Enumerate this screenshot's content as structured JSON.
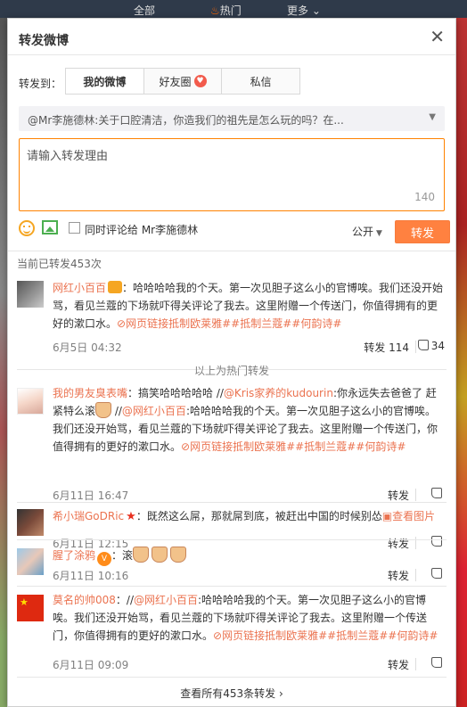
{
  "topnav": {
    "all": "全部",
    "hot": "热门",
    "more": "更多"
  },
  "dialog": {
    "title": "转发微博",
    "forward_to_label": "转发到：",
    "tabs": [
      {
        "label": "我的微博",
        "active": true
      },
      {
        "label": "好友圈",
        "active": false
      },
      {
        "label": "私信",
        "active": false
      }
    ],
    "quoted": "@Mr李施德林:关于口腔清洁，你造我们的祖先是怎么玩的吗？在...",
    "input_placeholder": "请输入转发理由",
    "char_count": "140",
    "also_comment_label": "同时评论给 Mr李施德林",
    "visibility": "公开",
    "forward_button": "转发",
    "count_line": "当前已转发453次",
    "hot_divider": "以上为热门转发",
    "footer_link": "查看所有453条转发",
    "accent_color": "#ff8140",
    "link_color": "#eb7350"
  },
  "items": [
    {
      "user": "网红小百百",
      "text": "：哈哈哈哈我的个天。第一次见胆子这么小的官博唉。我们还没开始骂，看见兰蔻的下场就吓得关评论了我去。这里附赠一个传送门，你值得拥有的更好的漱口水。",
      "link": "网页链接",
      "tail": "抵制欧莱雅##抵制兰蔻##何韵诗#",
      "date": "6月5日 04:32",
      "forward": "转发 114",
      "likes": "34"
    },
    {
      "user": "我的男友臭表嘴",
      "text1": "：搞笑哈哈哈哈哈 //",
      "mention1": "@Kris家养的kudourin",
      "text2": ":你永远失去爸爸了 赶紧特么滚",
      "text3": " //",
      "mention2": "@网红小百百",
      "text4": ":哈哈哈哈我的个天。第一次见胆子这么小的官博唉。我们还没开始骂，看见兰蔻的下场就吓得关评论了我去。这里附赠一个传送门，你值得拥有的更好的漱口水。",
      "link": "网页链接",
      "tail": "抵制欧莱雅##抵制兰蔻##何韵诗#",
      "date": "6月11日 16:47",
      "forward": "转发"
    },
    {
      "user": "希小瑞GoDRic",
      "text": "：既然这么屌，那就屌到底，被赶出中国的时候别怂",
      "link": "查看图片",
      "date": "6月11日 12:15",
      "forward": "转发"
    },
    {
      "user": "腥了涂鸦",
      "text": "：滚",
      "date": "6月11日 10:16",
      "forward": "转发"
    },
    {
      "user": "莫名的帅008",
      "text1": "：//",
      "mention": "@网红小百百",
      "text2": ":哈哈哈哈我的个天。第一次见胆子这么小的官博唉。我们还没开始骂，看见兰蔻的下场就吓得关评论了我去。这里附赠一个传送门，你值得拥有的更好的漱口水。",
      "link": "网页链接",
      "tail": "抵制欧莱雅##抵制兰蔻##何韵诗#",
      "date": "6月11日 09:09",
      "forward": "转发"
    }
  ]
}
